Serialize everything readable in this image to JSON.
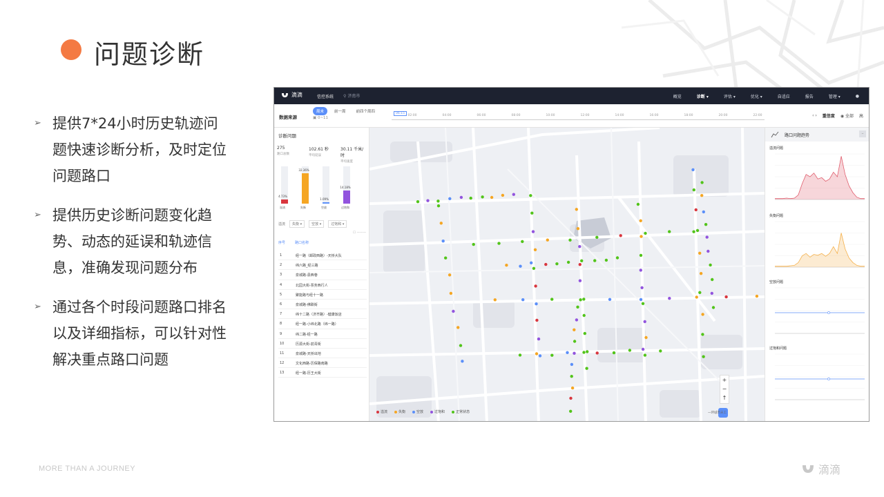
{
  "slide": {
    "title": "问题诊断",
    "bullets": [
      {
        "lines": [
          "提供7*24小时历史轨迹问",
          "题快速诊断分析，及时定位",
          "问题路口"
        ]
      },
      {
        "lines": [
          "提供历史诊断问题变化趋",
          "势、动态的延误和轨迹信",
          "息，准确发现问题分布"
        ]
      },
      {
        "lines": [
          "通过各个时段问题路口排名",
          "以及详细指标，可以针对性",
          "解决重点路口问题"
        ]
      }
    ],
    "footer_text": "MORE THAN A JOURNEY",
    "footer_logo": "滴滴",
    "accent_color": "#f47a43"
  },
  "app": {
    "logo": "滴滴",
    "system_name": "信控系统",
    "location": "济南市",
    "nav": [
      "概览",
      "诊断",
      "评估",
      "优化",
      "自适应",
      "报告",
      "管理"
    ],
    "active_nav": "诊断",
    "data_source_label": "数据来源",
    "tabs": [
      "周末",
      "前一周",
      "前四个周四"
    ],
    "active_tab": "周末",
    "time_label": "0~11",
    "timeline_marker": "06:15",
    "timeline_ticks": [
      "02:00",
      "04:00",
      "06:00",
      "08:00",
      "10:00",
      "12:00",
      "14:00",
      "16:00",
      "18:00",
      "20:00",
      "22:00"
    ],
    "right_controls": [
      "重信度",
      "全部",
      "高"
    ],
    "panel_title": "诊断问题",
    "stats": [
      {
        "value": "275",
        "label": "路口总数"
      },
      {
        "value": "102.61 秒",
        "label": "平均延误"
      },
      {
        "value": "30.11 千米/时",
        "label": "平均速度"
      }
    ],
    "bar_chart": [
      {
        "label": "溢流",
        "pct": "4.73%",
        "value": 4.73,
        "color": "#d9363e"
      },
      {
        "label": "失衡",
        "pct": "32.36%",
        "value": 32.36,
        "color": "#f5a623"
      },
      {
        "label": "空放",
        "pct": "1.09%",
        "value": 1.09,
        "color": "#5b8ff9"
      },
      {
        "label": "过饱和",
        "pct": "14.18%",
        "value": 14.18,
        "color": "#9254de"
      }
    ],
    "filters": [
      "溢流",
      "失衡",
      "空放",
      "过饱和"
    ],
    "table_header": [
      "序号",
      "路口名称"
    ],
    "table_rows": [
      {
        "no": "1",
        "name": "经一路（邮政西路）-天桥大队"
      },
      {
        "no": "2",
        "name": "纬六路_经三路"
      },
      {
        "no": "3",
        "name": "泉城路-县西巷"
      },
      {
        "no": "4",
        "name": "北园大街-票务西行人"
      },
      {
        "no": "5",
        "name": "聚能路与经十一路"
      },
      {
        "no": "6",
        "name": "泉城路-佛跌街"
      },
      {
        "no": "7",
        "name": "纬十二路（济齐路）-健康饭店"
      },
      {
        "no": "8",
        "name": "经一路-小纬北路（纬一路）"
      },
      {
        "no": "9",
        "name": "纬二路-经一路"
      },
      {
        "no": "10",
        "name": "历源大街-前青街"
      },
      {
        "no": "11",
        "name": "泉城路-天桥出地"
      },
      {
        "no": "12",
        "name": "文化西路-历保路南路"
      },
      {
        "no": "13",
        "name": "经一路-历王大街"
      }
    ],
    "legend": [
      {
        "label": "溢流",
        "color": "#d9363e"
      },
      {
        "label": "失衡",
        "color": "#f5a623"
      },
      {
        "label": "空放",
        "color": "#5b8ff9"
      },
      {
        "label": "过饱和",
        "color": "#9254de"
      },
      {
        "label": "正常状态",
        "color": "#52c41a"
      }
    ],
    "zoom_controls": [
      "+",
      "−",
      "↑"
    ],
    "map_scale": "一环城市天工",
    "right_panel_title": "路口问题趋势",
    "trend_charts": [
      {
        "title": "溢流问题",
        "color": "#e05c6c"
      },
      {
        "title": "失衡问题",
        "color": "#f5b14c"
      },
      {
        "title": "空放问题",
        "color": "#5b8ff9"
      },
      {
        "title": "过饱和问题",
        "color": "#5b8ff9"
      }
    ]
  }
}
